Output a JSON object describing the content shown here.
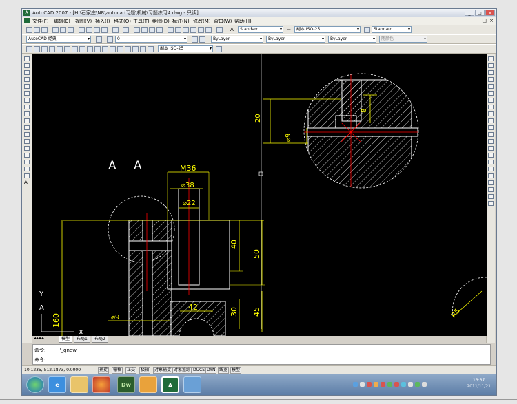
{
  "window": {
    "title": "AutoCAD 2007 - [H:\\石家庄\\NR\\autocad习题\\机械\\习题练习4.dwg - 只读]",
    "app_icon": "A",
    "controls": [
      "_",
      "□",
      "×"
    ],
    "doc_controls": [
      "_",
      "□",
      "×"
    ]
  },
  "menu": [
    "文件(F)",
    "编辑(E)",
    "视图(V)",
    "插入(I)",
    "格式(O)",
    "工具(T)",
    "绘图(D)",
    "标注(N)",
    "修改(M)",
    "窗口(W)",
    "帮助(H)"
  ],
  "toolbar1": {
    "text_style": "Standard",
    "dim_style": "副本 ISO-25",
    "table_style": "Standard"
  },
  "toolbar2": {
    "workspace": "AutoCAD 经典",
    "layer": "0",
    "color": "ByLayer",
    "linetype": "ByLayer",
    "lineweight": "ByLayer",
    "plot_style": "随颜色"
  },
  "toolbar3": {
    "dim_style": "副本 ISO-25"
  },
  "tabs": [
    "模型",
    "布局1",
    "布局2"
  ],
  "command": {
    "line1_prompt": "命令:",
    "line1_text": "'_qnew",
    "line2_prompt": "命令:"
  },
  "status": {
    "coords": "10.1235, 512.1873, 0.0000",
    "buttons": [
      "捕捉",
      "栅格",
      "正交",
      "极轴",
      "对象捕捉",
      "对象追踪",
      "DUCS",
      "DYN",
      "线宽",
      "模型"
    ]
  },
  "taskbar": {
    "apps": [
      "windows-start",
      "internet-explorer",
      "file-explorer",
      "firefox",
      "dreamweaver",
      "app",
      "autocad",
      "window"
    ],
    "dw_label": "Dw",
    "cad_label": "A",
    "time": "13:37",
    "date": "2011/11/21"
  },
  "drawing": {
    "section_mark_left": "A",
    "section_mark_right": "A",
    "view_label": "A",
    "dim_m36": "M36",
    "dim_d38": "⌀38",
    "dim_d22": "⌀22",
    "dim_40": "40",
    "dim_50": "50",
    "dim_30": "30",
    "dim_45": "45",
    "dim_42": "42",
    "dim_160": "160",
    "dim_d9_bottom": "⌀9",
    "dim_d9_detail": "⌀9",
    "dim_8": "8",
    "dim_20": "20",
    "dim_r5": "R5",
    "ucs_x": "X",
    "ucs_y": "Y",
    "colors": {
      "canvas": "#000000",
      "geometry": "#ffffff",
      "dimension": "#ffff00",
      "centerline": "#ff0000"
    }
  }
}
